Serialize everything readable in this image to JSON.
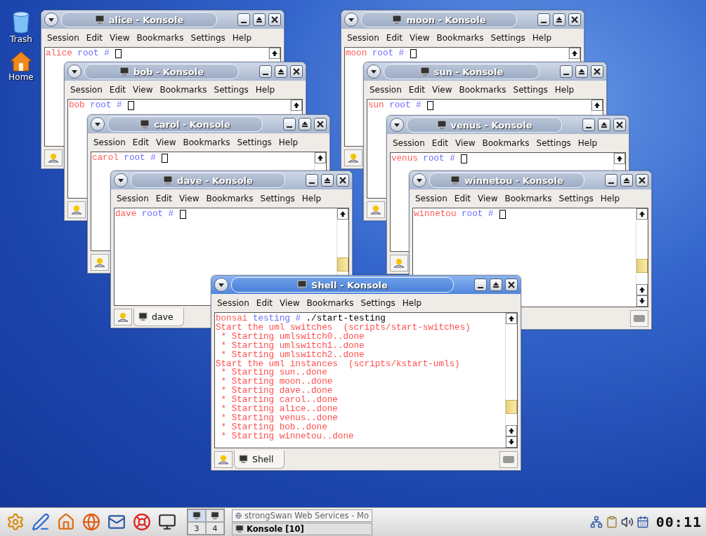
{
  "desktop_icons": [
    {
      "label": "Trash",
      "kind": "trash"
    },
    {
      "label": "Home",
      "kind": "home"
    }
  ],
  "windows": [
    {
      "title": "alice - Konsole",
      "active": false,
      "menu": [
        "Session",
        "Edit",
        "View",
        "Bookmarks",
        "Settings",
        "Help"
      ],
      "prompt": {
        "host": "alice",
        "user": "root",
        "symbol": "#"
      }
    },
    {
      "title": "moon - Konsole",
      "active": false,
      "menu": [
        "Session",
        "Edit",
        "View",
        "Bookmarks",
        "Settings",
        "Help"
      ],
      "prompt": {
        "host": "moon",
        "user": "root",
        "symbol": "#"
      }
    },
    {
      "title": "bob - Konsole",
      "active": false,
      "menu": [
        "Session",
        "Edit",
        "View",
        "Bookmarks",
        "Settings",
        "Help"
      ],
      "prompt": {
        "host": "bob",
        "user": "root",
        "symbol": "#"
      }
    },
    {
      "title": "sun - Konsole",
      "active": false,
      "menu": [
        "Session",
        "Edit",
        "View",
        "Bookmarks",
        "Settings",
        "Help"
      ],
      "prompt": {
        "host": "sun",
        "user": "root",
        "symbol": "#"
      }
    },
    {
      "title": "carol - Konsole",
      "active": false,
      "menu": [
        "Session",
        "Edit",
        "View",
        "Bookmarks",
        "Settings",
        "Help"
      ],
      "prompt": {
        "host": "carol",
        "user": "root",
        "symbol": "#"
      }
    },
    {
      "title": "venus - Konsole",
      "active": false,
      "menu": [
        "Session",
        "Edit",
        "View",
        "Bookmarks",
        "Settings",
        "Help"
      ],
      "prompt": {
        "host": "venus",
        "user": "root",
        "symbol": "#"
      }
    },
    {
      "title": "dave - Konsole",
      "active": false,
      "menu": [
        "Session",
        "Edit",
        "View",
        "Bookmarks",
        "Settings",
        "Help"
      ],
      "prompt": {
        "host": "dave",
        "user": "root",
        "symbol": "#"
      },
      "tab": "dave"
    },
    {
      "title": "winnetou - Konsole",
      "active": false,
      "menu": [
        "Session",
        "Edit",
        "View",
        "Bookmarks",
        "Settings",
        "Help"
      ],
      "prompt": {
        "host": "winnetou",
        "user": "root",
        "symbol": "#"
      }
    },
    {
      "title": "Shell - Konsole",
      "active": true,
      "menu": [
        "Session",
        "Edit",
        "View",
        "Bookmarks",
        "Settings",
        "Help"
      ],
      "prompt": {
        "host": "bonsai",
        "user": "testing",
        "symbol": "#",
        "command": "./start-testing"
      },
      "output": [
        "Start the uml switches  (scripts/start-switches)",
        " * Starting umlswitch0..done",
        " * Starting umlswitch1..done",
        " * Starting umlswitch2..done",
        "Start the uml instances  (scripts/kstart-umls)",
        " * Starting sun..done",
        " * Starting moon..done",
        " * Starting dave..done",
        " * Starting carol..done",
        " * Starting alice..done",
        " * Starting venus..done",
        " * Starting bob..done",
        " * Starting winnetou..done"
      ],
      "tab": "Shell"
    }
  ],
  "taskbar": {
    "pager": [
      "3",
      "4"
    ],
    "tasks": [
      {
        "label": "strongSwan Web Services - Mo",
        "selected": false
      },
      {
        "label": "Konsole [10]",
        "selected": true
      }
    ],
    "clock": "00:11"
  }
}
